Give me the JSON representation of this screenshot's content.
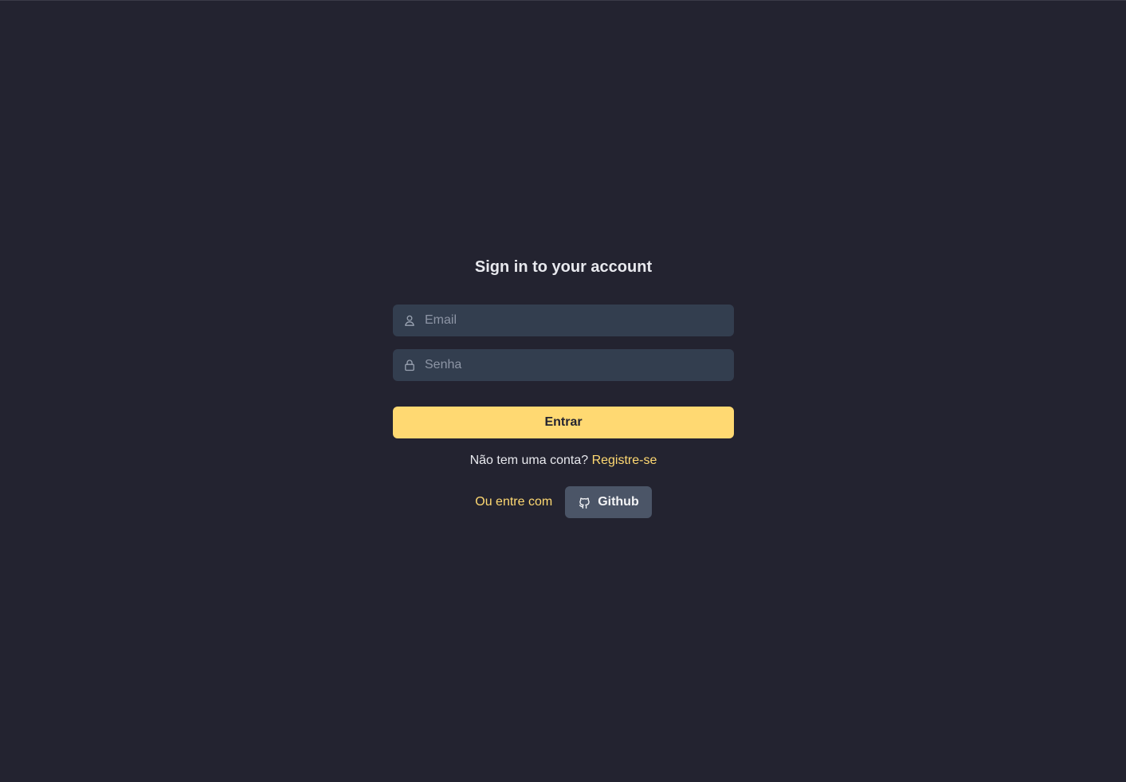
{
  "page": {
    "background": "#232330"
  },
  "login": {
    "title": "Sign in to your account",
    "email": {
      "placeholder": "Email",
      "value": "",
      "icon": "user-icon"
    },
    "password": {
      "placeholder": "Senha",
      "value": "",
      "icon": "lock-icon"
    },
    "submit_label": "Entrar",
    "register_prompt": "Não tem uma conta?",
    "register_link": "Registre-se",
    "social_label": "Ou entre com",
    "github_label": "Github",
    "github_icon": "github-icon"
  },
  "colors": {
    "accent": "#ffd972",
    "input_bg": "#333e4f",
    "secondary_button": "#4b5567",
    "text": "#e8e9ee",
    "placeholder": "#8d95a5"
  }
}
